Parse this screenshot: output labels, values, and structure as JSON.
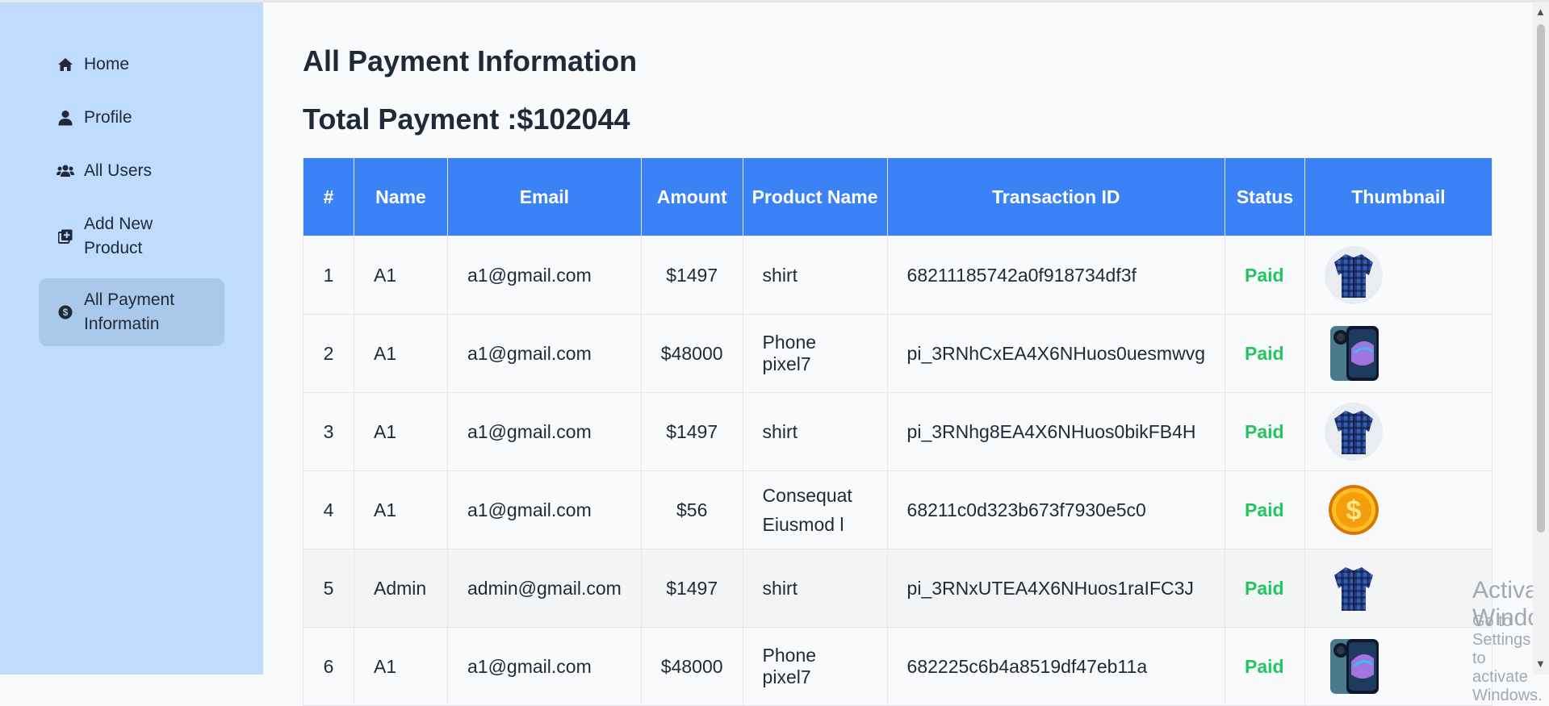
{
  "sidebar": {
    "items": [
      {
        "label": "Home",
        "icon": "home-icon",
        "active": false
      },
      {
        "label": "Profile",
        "icon": "user-icon",
        "active": false
      },
      {
        "label": "All Users",
        "icon": "users-icon",
        "active": false
      },
      {
        "label": "Add New Product",
        "icon": "add-product-icon",
        "active": false
      },
      {
        "label": "All Payment Informatin",
        "icon": "dollar-circle-icon",
        "active": true
      }
    ]
  },
  "main": {
    "title": "All Payment Information",
    "total": "Total Payment :$102044"
  },
  "table": {
    "headers": [
      "#",
      "Name",
      "Email",
      "Amount",
      "Product Name",
      "Transaction ID",
      "Status",
      "Thumbnail"
    ],
    "rows": [
      {
        "num": "1",
        "name": "A1",
        "email": "a1@gmail.com",
        "amount": "$1497",
        "product": "shirt",
        "tx": "68211185742a0f918734df3f",
        "status": "Paid",
        "thumb": "shirt-thumbnail"
      },
      {
        "num": "2",
        "name": "A1",
        "email": "a1@gmail.com",
        "amount": "$48000",
        "product": "Phone pixel7",
        "tx": "pi_3RNhCxEA4X6NHuos0uesmwvg",
        "status": "Paid",
        "thumb": "phone-thumbnail"
      },
      {
        "num": "3",
        "name": "A1",
        "email": "a1@gmail.com",
        "amount": "$1497",
        "product": "shirt",
        "tx": "pi_3RNhg8EA4X6NHuos0bikFB4H",
        "status": "Paid",
        "thumb": "shirt-thumbnail"
      },
      {
        "num": "4",
        "name": "A1",
        "email": "a1@gmail.com",
        "amount": "$56",
        "product": "Consequat Eiusmod l",
        "tx": "68211c0d323b673f7930e5c0",
        "status": "Paid",
        "thumb": "coin-thumbnail"
      },
      {
        "num": "5",
        "name": "Admin",
        "email": "admin@gmail.com",
        "amount": "$1497",
        "product": "shirt",
        "tx": "pi_3RNxUTEA4X6NHuos1raIFC3J",
        "status": "Paid",
        "thumb": "shirt-thumbnail"
      },
      {
        "num": "6",
        "name": "A1",
        "email": "a1@gmail.com",
        "amount": "$48000",
        "product": "Phone pixel7",
        "tx": "682225c6b4a8519df47eb11a",
        "status": "Paid",
        "thumb": "phone-thumbnail"
      }
    ]
  },
  "watermark": {
    "line1": "Activate Windows",
    "line2": "Go to Settings to activate Windows."
  },
  "colors": {
    "sidebar_bg": "#bfdbfe",
    "header_bg": "#3b82f6",
    "paid": "#22c55e",
    "active_item": "#aac8ea"
  }
}
